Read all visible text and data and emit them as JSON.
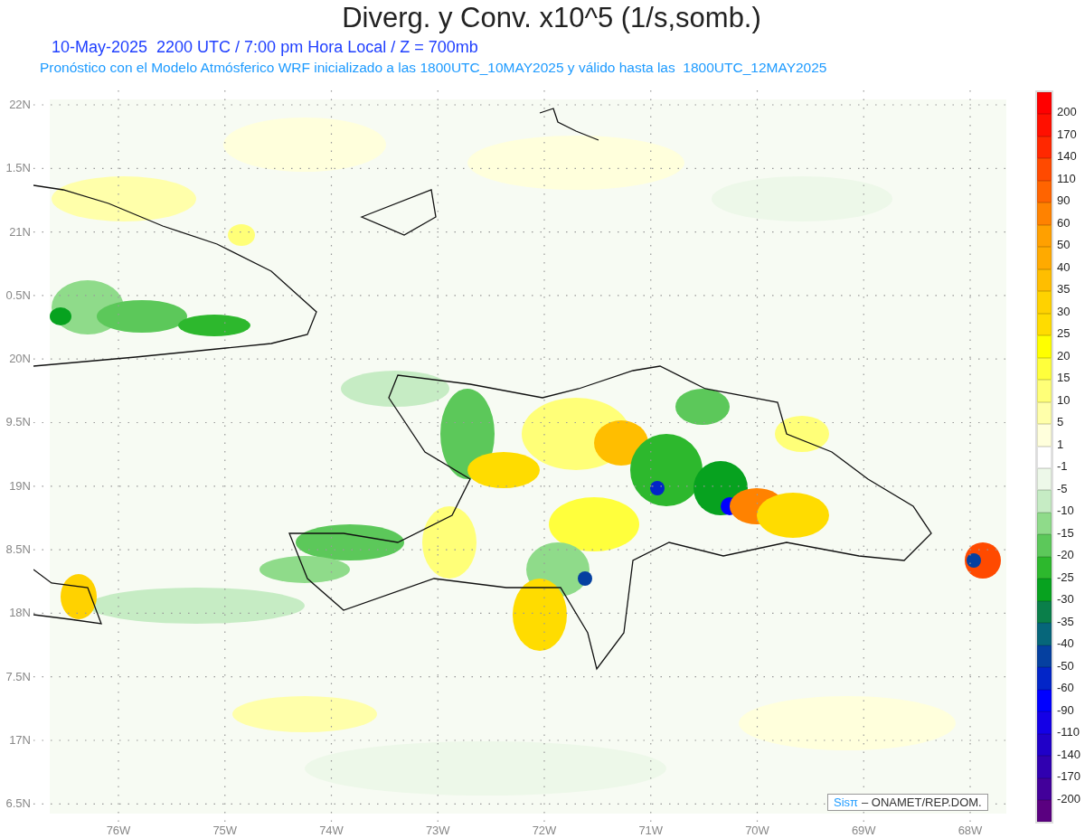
{
  "title": "Diverg. y Conv. x10^5 (1/s,somb.)",
  "subtitle": "10-May-2025  2200 UTC / 7:00 pm Hora Local / Z = 700mb",
  "description": "Pronóstico con el Modelo Atmósferico WRF inicializado a las 1800UTC_10MAY2025 y válido hasta las  1800UTC_12MAY2025",
  "map": {
    "lat_labels": [
      "22N",
      "1.5N",
      "21N",
      "0.5N",
      "20N",
      "9.5N",
      "19N",
      "8.5N",
      "18N",
      "7.5N",
      "17N",
      "6.5N"
    ],
    "lon_labels": [
      "76W",
      "75W",
      "74W",
      "73W",
      "72W",
      "71W",
      "70W",
      "69W",
      "68W"
    ]
  },
  "colorbar": {
    "bins": [
      {
        "color": "#ff0000"
      },
      {
        "color": "#ff1000"
      },
      {
        "color": "#ff2800"
      },
      {
        "color": "#ff4a00"
      },
      {
        "color": "#ff6400"
      },
      {
        "color": "#ff8200"
      },
      {
        "color": "#ffa000"
      },
      {
        "color": "#ffaa00"
      },
      {
        "color": "#ffbe00"
      },
      {
        "color": "#ffd200"
      },
      {
        "color": "#ffdc00"
      },
      {
        "color": "#ffff00"
      },
      {
        "color": "#ffff3c"
      },
      {
        "color": "#ffff78"
      },
      {
        "color": "#ffffaa"
      },
      {
        "color": "#ffffdc"
      },
      {
        "color": "#ffffff"
      },
      {
        "color": "#edf8e9"
      },
      {
        "color": "#c6ecc4"
      },
      {
        "color": "#8fdb8a"
      },
      {
        "color": "#5cc85a"
      },
      {
        "color": "#2db82d"
      },
      {
        "color": "#07a21f"
      },
      {
        "color": "#0a7f4a"
      },
      {
        "color": "#06667a"
      },
      {
        "color": "#0540a0"
      },
      {
        "color": "#0225c8"
      },
      {
        "color": "#0000ff"
      },
      {
        "color": "#1400e6"
      },
      {
        "color": "#2000c8"
      },
      {
        "color": "#3000b0"
      },
      {
        "color": "#42009a"
      },
      {
        "color": "#5a0080"
      }
    ],
    "labels": [
      "200",
      "170",
      "140",
      "110",
      "90",
      "60",
      "50",
      "40",
      "35",
      "30",
      "25",
      "20",
      "15",
      "10",
      "5",
      "1",
      "-1",
      "-5",
      "-10",
      "-15",
      "-20",
      "-25",
      "-30",
      "-35",
      "-40",
      "-50",
      "-60",
      "-90",
      "-110",
      "-140",
      "-170",
      "-200"
    ]
  },
  "credit": {
    "brand": "Sisπ",
    "text": "– ONAMET/REP.DOM."
  }
}
